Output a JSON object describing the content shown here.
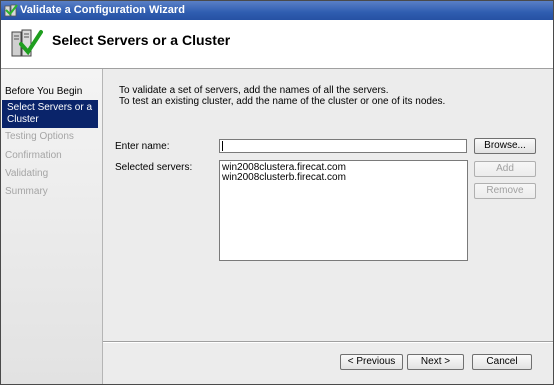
{
  "window": {
    "title": "Validate a Configuration Wizard"
  },
  "header": {
    "title": "Select Servers or a Cluster"
  },
  "sidebar": {
    "items": [
      {
        "label": "Before You Begin",
        "state": "done"
      },
      {
        "label": "Select Servers or a Cluster",
        "state": "active"
      },
      {
        "label": "Testing Options",
        "state": "pending"
      },
      {
        "label": "Confirmation",
        "state": "pending"
      },
      {
        "label": "Validating",
        "state": "pending"
      },
      {
        "label": "Summary",
        "state": "pending"
      }
    ]
  },
  "main": {
    "intro_line1": "To validate a set of servers, add the names of all the servers.",
    "intro_line2": "To test an existing cluster, add the name of the cluster or one of its nodes.",
    "enter_name_label": "Enter name:",
    "enter_name_value": "",
    "selected_servers_label": "Selected servers:",
    "selected_servers": [
      "win2008clustera.firecat.com",
      "win2008clusterb.firecat.com"
    ],
    "browse_label": "Browse...",
    "add_label": "Add",
    "remove_label": "Remove"
  },
  "footer": {
    "previous_label": "< Previous",
    "next_label": "Next >",
    "cancel_label": "Cancel"
  },
  "colors": {
    "titlebar": "#2f5db0",
    "sidebar_active": "#0a246a",
    "disabled_text": "#a5a5a5"
  },
  "icons": {
    "title": "cluster-check-icon",
    "header": "servers-check-icon"
  }
}
